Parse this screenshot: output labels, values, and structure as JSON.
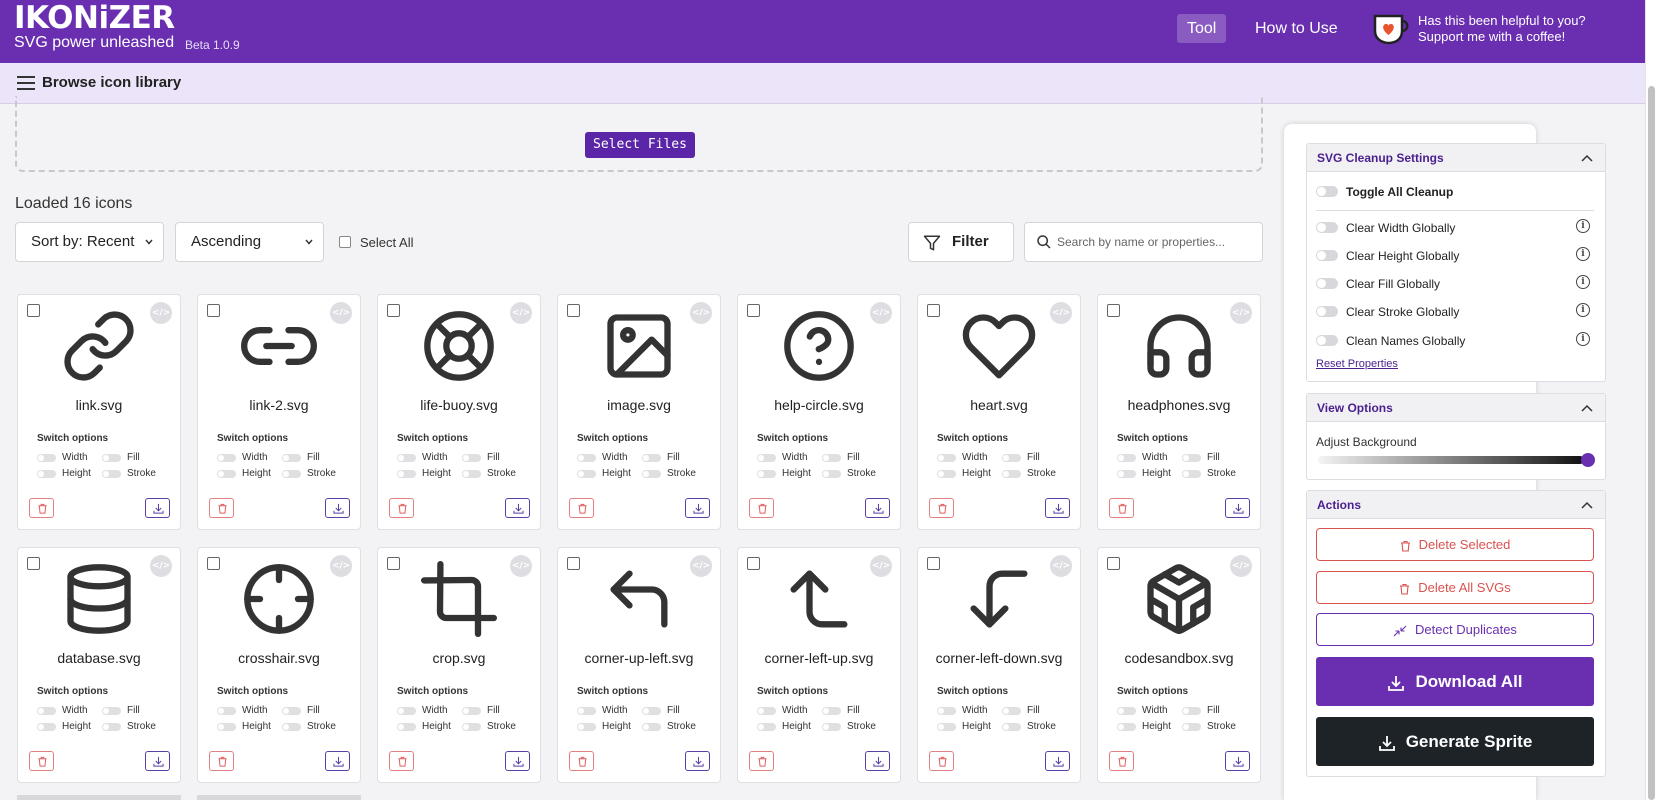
{
  "header": {
    "logo": "IKONiZER",
    "tagline": "SVG power unleashed",
    "version": "Beta 1.0.9",
    "nav": [
      "Tool",
      "How to Use"
    ],
    "support_line1": "Has this been helpful to you?",
    "support_line2": "Support me with a coffee!",
    "accent": "#6a2fb0"
  },
  "subbar": {
    "label": "Browse icon library",
    "icon": "menu-icon"
  },
  "upload": {
    "button": "Select Files"
  },
  "toolbar": {
    "loaded": "Loaded 16 icons",
    "sort": "Sort by: Recent",
    "order": "Ascending",
    "select_all": "Select All",
    "filter": "Filter",
    "search_placeholder": "Search by name or properties..."
  },
  "card_labels": {
    "switch_title": "Switch options",
    "width": "Width",
    "fill": "Fill",
    "height": "Height",
    "stroke": "Stroke",
    "code": "</>"
  },
  "icons": [
    {
      "file": "link.svg",
      "icon": "link-icon"
    },
    {
      "file": "link-2.svg",
      "icon": "link-2-icon"
    },
    {
      "file": "life-buoy.svg",
      "icon": "life-buoy-icon"
    },
    {
      "file": "image.svg",
      "icon": "image-icon"
    },
    {
      "file": "help-circle.svg",
      "icon": "help-circle-icon"
    },
    {
      "file": "heart.svg",
      "icon": "heart-icon"
    },
    {
      "file": "headphones.svg",
      "icon": "headphones-icon"
    },
    {
      "file": "database.svg",
      "icon": "database-icon"
    },
    {
      "file": "crosshair.svg",
      "icon": "crosshair-icon"
    },
    {
      "file": "crop.svg",
      "icon": "crop-icon"
    },
    {
      "file": "corner-up-left.svg",
      "icon": "corner-up-left-icon"
    },
    {
      "file": "corner-left-up.svg",
      "icon": "corner-left-up-icon"
    },
    {
      "file": "corner-left-down.svg",
      "icon": "corner-left-down-icon"
    },
    {
      "file": "codesandbox.svg",
      "icon": "codesandbox-icon"
    }
  ],
  "sidebar": {
    "cleanup": {
      "title": "SVG Cleanup Settings",
      "toggle_all": "Toggle All Cleanup",
      "options": [
        "Clear Width Globally",
        "Clear Height Globally",
        "Clear Fill Globally",
        "Clear Stroke Globally",
        "Clean Names Globally"
      ],
      "info": "i",
      "reset": "Reset Properties"
    },
    "view": {
      "title": "View Options",
      "adjust": "Adjust Background",
      "background_level": 1.0
    },
    "actions": {
      "title": "Actions",
      "delete_selected": "Delete Selected",
      "delete_all": "Delete All SVGs",
      "detect_dupes": "Detect Duplicates",
      "download_all": "Download All",
      "sprite": "Generate Sprite",
      "download_color": "#6a2fb0",
      "sprite_color": "#1e2328"
    }
  }
}
